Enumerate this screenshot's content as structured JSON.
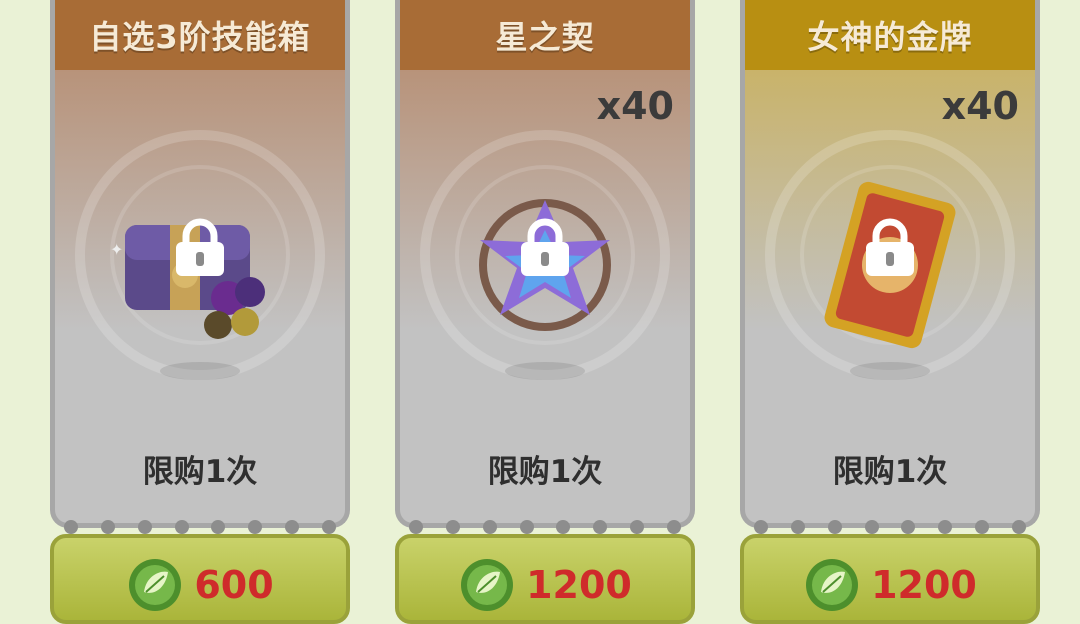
{
  "cards": [
    {
      "title": "自选3阶技能箱",
      "quantity": "",
      "limit": "限购1次",
      "price": "600",
      "header_color": "#a86c36",
      "item": "skill-chest-icon"
    },
    {
      "title": "星之契",
      "quantity": "x40",
      "limit": "限购1次",
      "price": "1200",
      "header_color": "#a86c36",
      "item": "star-pact-icon"
    },
    {
      "title": "女神的金牌",
      "quantity": "x40",
      "limit": "限购1次",
      "price": "1200",
      "header_color": "#b88f12",
      "item": "goddess-medal-icon"
    }
  ],
  "colors": {
    "locked_body": "#c2c2c2",
    "price_text": "#cf2b2b",
    "button": "#b9c24a"
  },
  "icons": {
    "lock": "lock-icon",
    "currency": "leaf-orb-icon"
  }
}
